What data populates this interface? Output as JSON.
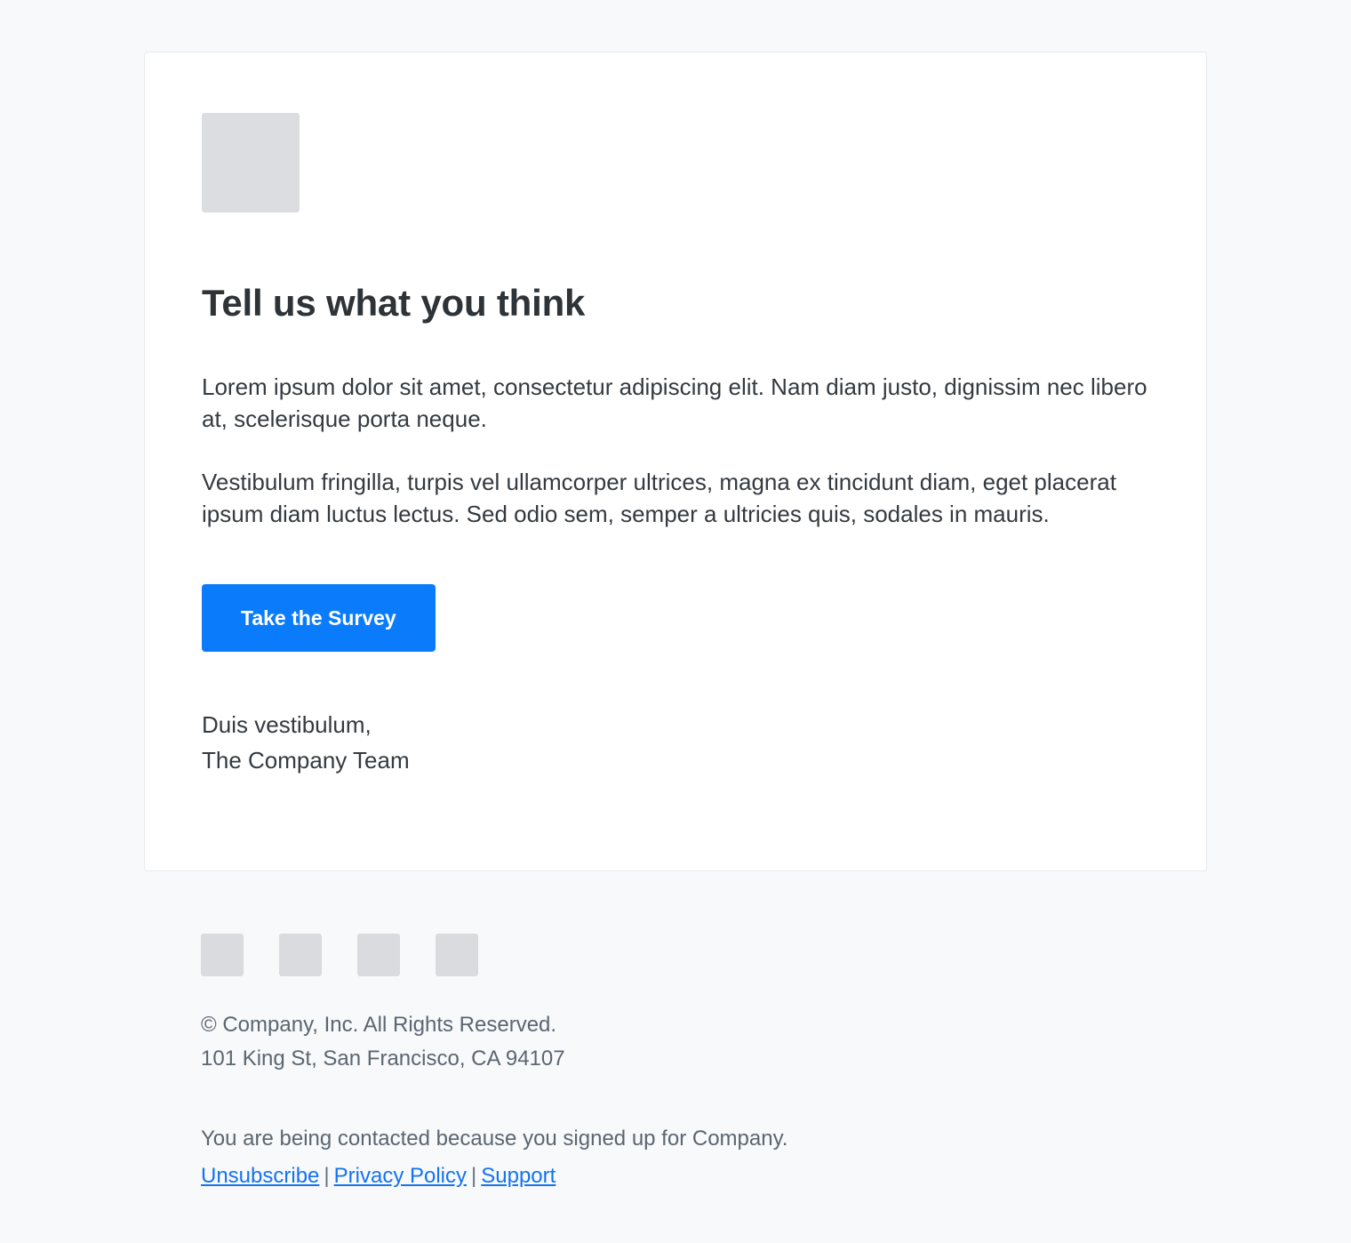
{
  "colors": {
    "page_background": "#f7f9fb",
    "card_background": "#ffffff",
    "card_border": "#e8eaec",
    "heading_text": "#2e3338",
    "body_text": "#343a40",
    "footer_text": "#5c6670",
    "accent_blue": "#0a7cfb",
    "link_blue": "#1673ef",
    "placeholder_gray": "#dcdde0"
  },
  "email": {
    "logo": {
      "name": "logo-placeholder",
      "alt": ""
    },
    "heading": "Tell us what you think",
    "paragraphs": [
      "Lorem ipsum dolor sit amet, consectetur adipiscing elit. Nam diam justo, dignissim nec libero at, scelerisque porta neque.",
      "Vestibulum fringilla, turpis vel ullamcorper ultrices, magna ex tincidunt diam, eget placerat ipsum diam luctus lectus. Sed odio sem, semper a ultricies quis, sodales in mauris."
    ],
    "cta": {
      "label": "Take the Survey"
    },
    "signature": {
      "line1": "Duis vestibulum,",
      "line2": "The Company Team"
    }
  },
  "footer": {
    "social_icons": [
      {
        "name": "social-icon-1"
      },
      {
        "name": "social-icon-2"
      },
      {
        "name": "social-icon-3"
      },
      {
        "name": "social-icon-4"
      }
    ],
    "copyright": "© Company, Inc. All Rights Reserved.",
    "address": "101 King St, San Francisco, CA 94107",
    "contact_reason": "You are being contacted because you signed up for Company.",
    "links": {
      "unsubscribe": "Unsubscribe",
      "privacy": "Privacy Policy",
      "support": "Support",
      "separator": "|"
    }
  }
}
